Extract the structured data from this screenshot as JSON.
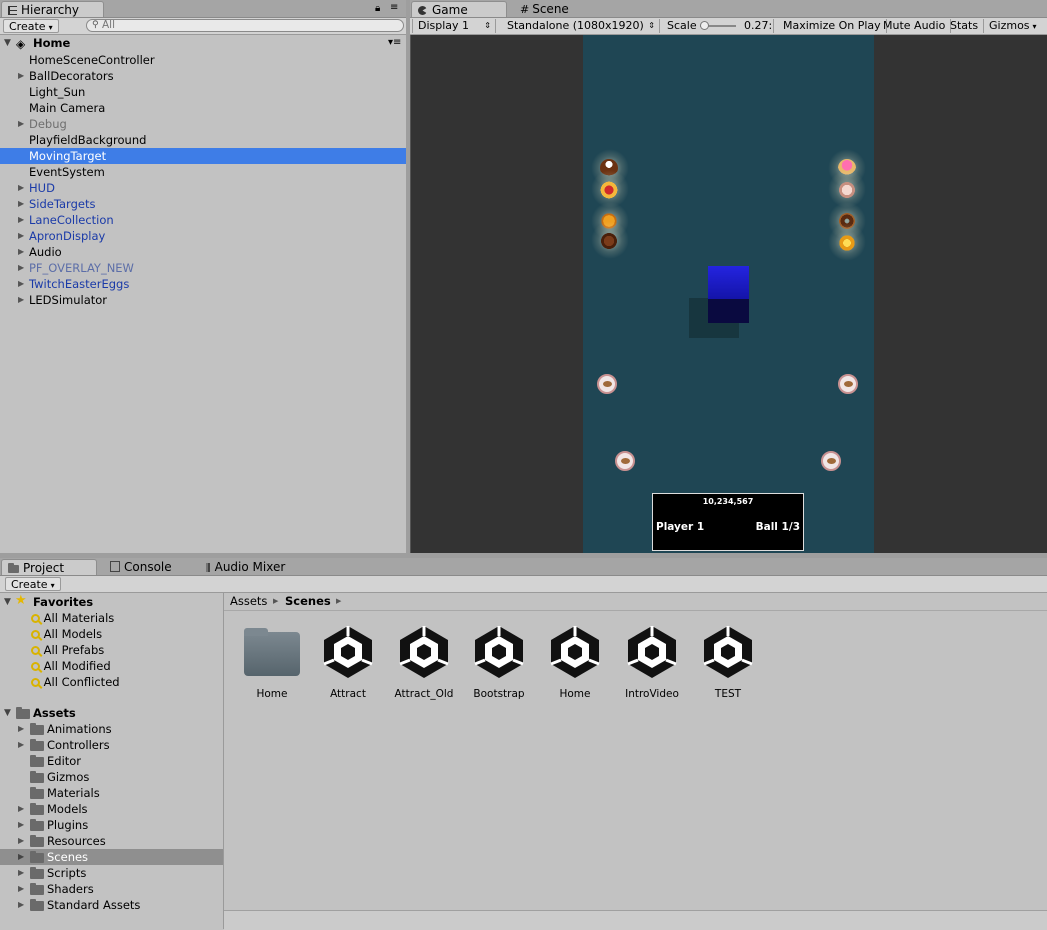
{
  "hierarchy": {
    "tab": "Hierarchy",
    "create": "Create",
    "search_placeholder": "All",
    "scene": "Home",
    "items": [
      {
        "label": "HomeSceneController"
      },
      {
        "label": "BallDecorators"
      },
      {
        "label": "Light_Sun"
      },
      {
        "label": "Main Camera"
      },
      {
        "label": "Debug"
      },
      {
        "label": "PlayfieldBackground"
      },
      {
        "label": "MovingTarget"
      },
      {
        "label": "EventSystem"
      },
      {
        "label": "HUD"
      },
      {
        "label": "SideTargets"
      },
      {
        "label": "LaneCollection"
      },
      {
        "label": "ApronDisplay"
      },
      {
        "label": "Audio"
      },
      {
        "label": "PF_OVERLAY_NEW"
      },
      {
        "label": "TwitchEasterEggs"
      },
      {
        "label": "LEDSimulator"
      }
    ]
  },
  "game": {
    "tabs": [
      "Game",
      "Scene"
    ],
    "display": "Display 1",
    "resolution": "Standalone (1080x1920)",
    "scale_label": "Scale",
    "scale_value": "0.27:",
    "maximize": "Maximize On Play",
    "mute": "Mute Audio",
    "stats": "Stats",
    "gizmos": "Gizmos",
    "hud_score": "10,234,567",
    "hud_player": "Player 1",
    "hud_ball": "Ball 1/3"
  },
  "project": {
    "tabs": [
      "Project",
      "Console",
      "Audio Mixer"
    ],
    "create": "Create",
    "favorites_label": "Favorites",
    "favorites": [
      "All Materials",
      "All Models",
      "All Prefabs",
      "All Modified",
      "All Conflicted"
    ],
    "assets_label": "Assets",
    "folders": [
      "Animations",
      "Controllers",
      "Editor",
      "Gizmos",
      "Materials",
      "Models",
      "Plugins",
      "Resources",
      "Scenes",
      "Scripts",
      "Shaders",
      "Standard Assets"
    ],
    "breadcrumb": [
      "Assets",
      "Scenes"
    ],
    "grid_items": [
      "Home",
      "Attract",
      "Attract_Old",
      "Bootstrap",
      "Home",
      "IntroVideo",
      "TEST"
    ]
  },
  "colors": {
    "selection": "#3e7de7",
    "playfield": "#1f4654",
    "prefab_text": "#1a3aa8"
  }
}
